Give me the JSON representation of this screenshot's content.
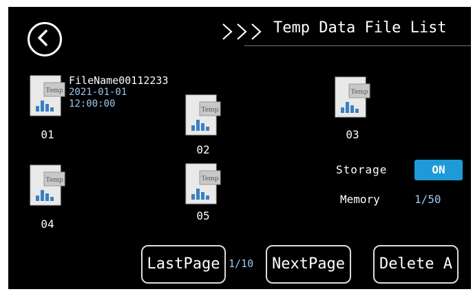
{
  "header": {
    "title": "Temp Data File List"
  },
  "files": [
    {
      "number": "01",
      "name": "FileName00112233",
      "date": "2021-01-01",
      "time": "12:00:00"
    },
    {
      "number": "02"
    },
    {
      "number": "03"
    },
    {
      "number": "04"
    },
    {
      "number": "05"
    }
  ],
  "file_icon": {
    "tag": "Temp",
    "icon": "temp-file-icon"
  },
  "settings": {
    "storage_label": "Storage",
    "storage_value": "ON",
    "memory_label": "Memory",
    "memory_value": "1/50"
  },
  "pagination": {
    "last_label": "LastPage",
    "page_indicator": "1/10",
    "next_label": "NextPage",
    "delete_label": "Delete A"
  },
  "colors": {
    "accent": "#1f9ad8",
    "info_text": "#9ec9f0",
    "background": "#000000"
  }
}
